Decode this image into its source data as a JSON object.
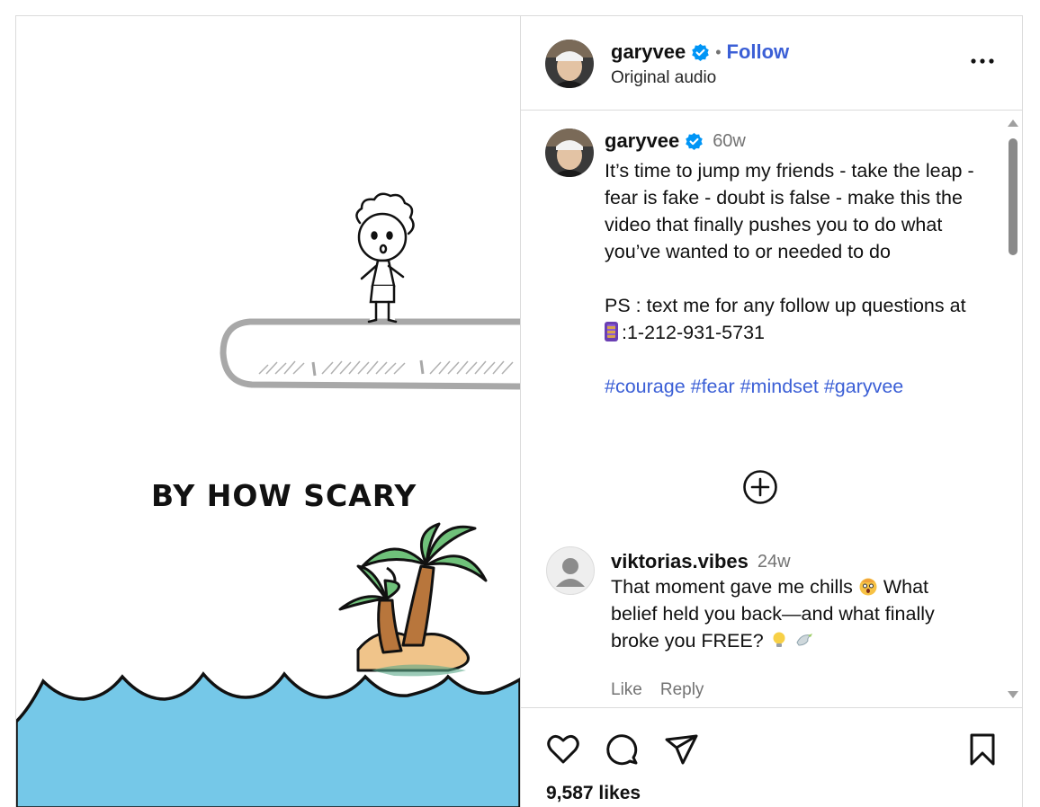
{
  "post": {
    "username": "garyvee",
    "follow_label": "Follow",
    "separator": "•",
    "audio_label": "Original audio",
    "more_icon": "more-horizontal-icon"
  },
  "caption": {
    "username": "garyvee",
    "time": "60w",
    "text": "It’s time to jump my friends - take the leap - fear is fake - doubt is false - make this the video that finally pushes you to do what you’ve wanted to or needed to do\n\nPS : text me for any follow up questions at ",
    "phone_icon": "mobile-phone-emoji",
    "phone_number": ":1-212-931-5731",
    "hashtags": "#courage #fear #mindset #garyvee"
  },
  "load_more_icon": "plus-circle-icon",
  "comment": {
    "username": "viktorias.vibes",
    "time": "24w",
    "text_part1": "That moment gave me chills ",
    "text_part2": " What belief held you back—and what finally broke you FREE? ",
    "emojis": [
      "shocked-face-emoji",
      "light-bulb-emoji",
      "dove-emoji"
    ],
    "like_label": "Like",
    "reply_label": "Reply"
  },
  "media": {
    "overlay_text": "BY HOW SCARY",
    "colors": {
      "sea": "#75c8e8",
      "sand": "#f0c48a",
      "palm_leaf": "#6fc17a",
      "trunk": "#b8763c",
      "ledge": "#a8a8a8"
    }
  },
  "actions": {
    "icons": [
      "heart-icon",
      "comment-icon",
      "share-icon",
      "bookmark-icon"
    ],
    "likes": "9,587 likes"
  },
  "colors": {
    "link": "#3b5fd6",
    "verified": "#0095f6",
    "muted": "#737373",
    "border": "#dbdbdb"
  }
}
